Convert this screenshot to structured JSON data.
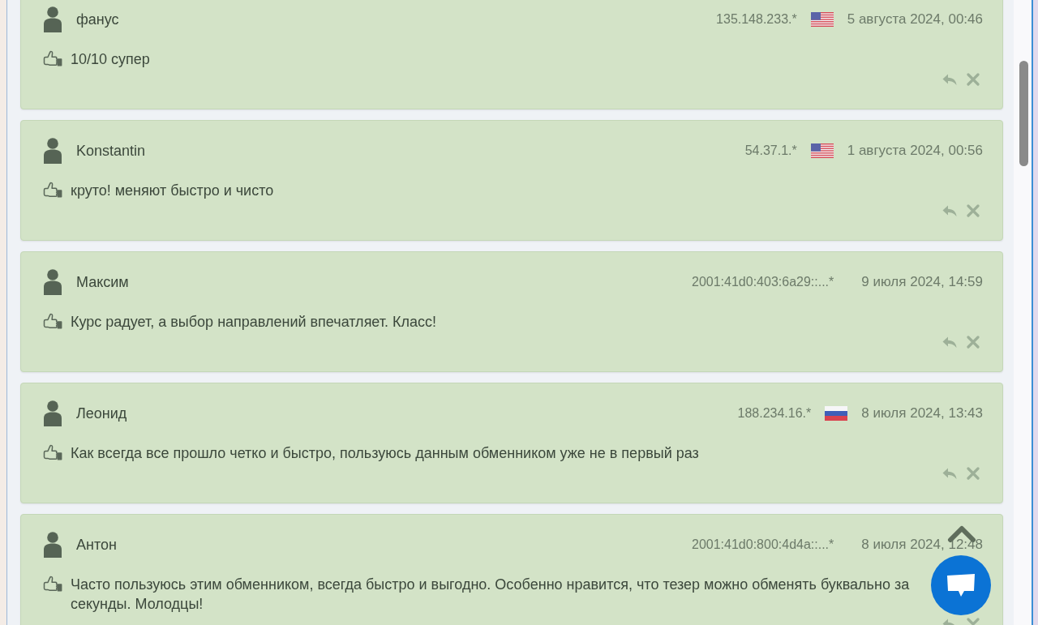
{
  "comments": [
    {
      "author": "фанус",
      "ip": "135.148.233.*",
      "flag": {
        "kind": "us"
      },
      "date": "5 августа 2024, 00:46",
      "text": "10/10 супер"
    },
    {
      "author": "Konstantin",
      "ip": "54.37.1.*",
      "flag": {
        "kind": "us"
      },
      "date": "1 августа 2024, 00:56",
      "text": "круто! меняют быстро и чисто"
    },
    {
      "author": "Максим",
      "ip": "2001:41d0:403:6a29::...*",
      "date": "9 июля 2024, 14:59",
      "text": "Курс радует, а выбор направлений впечатляет. Класс!"
    },
    {
      "author": "Леонид",
      "ip": "188.234.16.*",
      "flag": {
        "kind": "ru"
      },
      "date": "8 июля 2024, 13:43",
      "text": "Как всегда все прошло четко и быстро, пользуюсь данным обменником уже не в первый раз"
    },
    {
      "author": "Антон",
      "ip": "2001:41d0:800:4d4a::...*",
      "date": "8 июля 2024, 12:48",
      "text": "Часто пользуюсь этим обменником, всегда быстро и выгодно. Особенно нравится, что тезер можно обменять буквально за секунды. Молодцы!"
    }
  ]
}
